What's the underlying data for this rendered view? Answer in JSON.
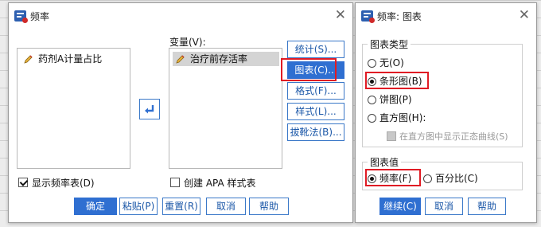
{
  "dialog1": {
    "title": "频率",
    "source_list": [
      "药剂A计量占比"
    ],
    "variables_label": "变量(V):",
    "variables_list": [
      "治疗前存活率"
    ],
    "side_buttons": [
      "统计(S)...",
      "图表(C)...",
      "格式(F)...",
      "样式(L)...",
      "拔靴法(B)..."
    ],
    "display_freq_label": "显示频率表(D)",
    "display_freq_checked": true,
    "apa_label": "创建 APA 样式表",
    "apa_checked": false,
    "bottom_buttons": [
      "确定",
      "粘贴(P)",
      "重置(R)",
      "取消",
      "帮助"
    ]
  },
  "dialog2": {
    "title": "频率: 图表",
    "chart_type_title": "图表类型",
    "chart_types": [
      "无(O)",
      "条形图(B)",
      "饼图(P)",
      "直方图(H):"
    ],
    "chart_type_selected": 1,
    "normal_curve_label": "在直方图中显示正态曲线(S)",
    "chart_values_title": "图表值",
    "chart_values": [
      "频率(F)",
      "百分比(C)"
    ],
    "chart_values_selected": 0,
    "buttons": [
      "继续(C)",
      "取消",
      "帮助"
    ]
  },
  "colors": {
    "accent": "#2f6fd1",
    "highlight": "#e01b24"
  },
  "icons": {
    "close": "close-icon",
    "move": "arrow-move-icon",
    "variable": "pencil-icon"
  }
}
